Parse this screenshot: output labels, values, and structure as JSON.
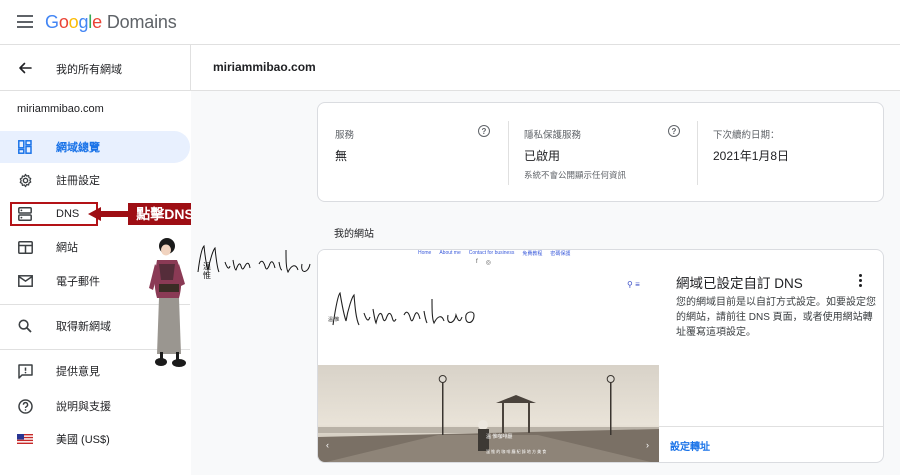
{
  "app": {
    "logo_google_letters": [
      "G",
      "o",
      "o",
      "g",
      "l",
      "e"
    ],
    "logo_product": "Domains"
  },
  "subbar": {
    "back_label": "我的所有網域",
    "domain_title": "miriammibao.com"
  },
  "sidebar": {
    "domain": "miriammibao.com",
    "items": [
      {
        "label": "網域總覽",
        "icon": "dashboard-icon",
        "active": true
      },
      {
        "label": "註冊設定",
        "icon": "gear-icon",
        "active": false
      },
      {
        "label": "DNS",
        "icon": "dns-icon",
        "active": false
      },
      {
        "label": "網站",
        "icon": "web-icon",
        "active": false
      },
      {
        "label": "電子郵件",
        "icon": "mail-icon",
        "active": false
      },
      {
        "label": "取得新網域",
        "icon": "search-icon",
        "active": false
      },
      {
        "label": "提供意見",
        "icon": "feedback-icon",
        "active": false
      },
      {
        "label": "說明與支援",
        "icon": "help-icon",
        "active": false
      },
      {
        "label": "美國 (US$)",
        "icon": "us-flag-icon",
        "active": false
      }
    ]
  },
  "annotation": {
    "callout_label": "點擊DNS",
    "handwritten_signature": "Miriam mibao",
    "handwritten_chinese": "溫 惟",
    "highlight_color": "#b31217",
    "callout_color": "#9e0e14"
  },
  "info_card": {
    "columns": [
      {
        "heading": "服務",
        "value": "無",
        "sub": "",
        "help": true
      },
      {
        "heading": "隱私保護服務",
        "value": "已啟用",
        "sub": "系統不會公開顯示任何資訊",
        "help": true
      },
      {
        "heading": "下次續約日期：",
        "value": "2021年1月8日",
        "sub": "",
        "help": false
      }
    ]
  },
  "website_section": {
    "title": "我的網站",
    "preview": {
      "nav": [
        "Home",
        "About me",
        "Contact for business",
        "免費教程",
        "密碼保護"
      ],
      "signature": "Miriam mibao",
      "signature_chinese": "溫 惟",
      "caption_title": "溫 惟咖啡廳",
      "caption_sub": "溫 惟 的 咖 啡 廳 紀 錄 地 方 美 食"
    },
    "card_title": "網域已設定自訂 DNS",
    "card_desc": "您的網域目前是以自訂方式設定。如要設定您的網站，請前往 DNS 頁面，或者使用網站轉址覆寫這項設定。",
    "card_link": "設定轉址"
  },
  "colors": {
    "accent_blue": "#1a73e8",
    "active_bg": "#e8f0fe",
    "page_bg": "#f8f9fa"
  }
}
